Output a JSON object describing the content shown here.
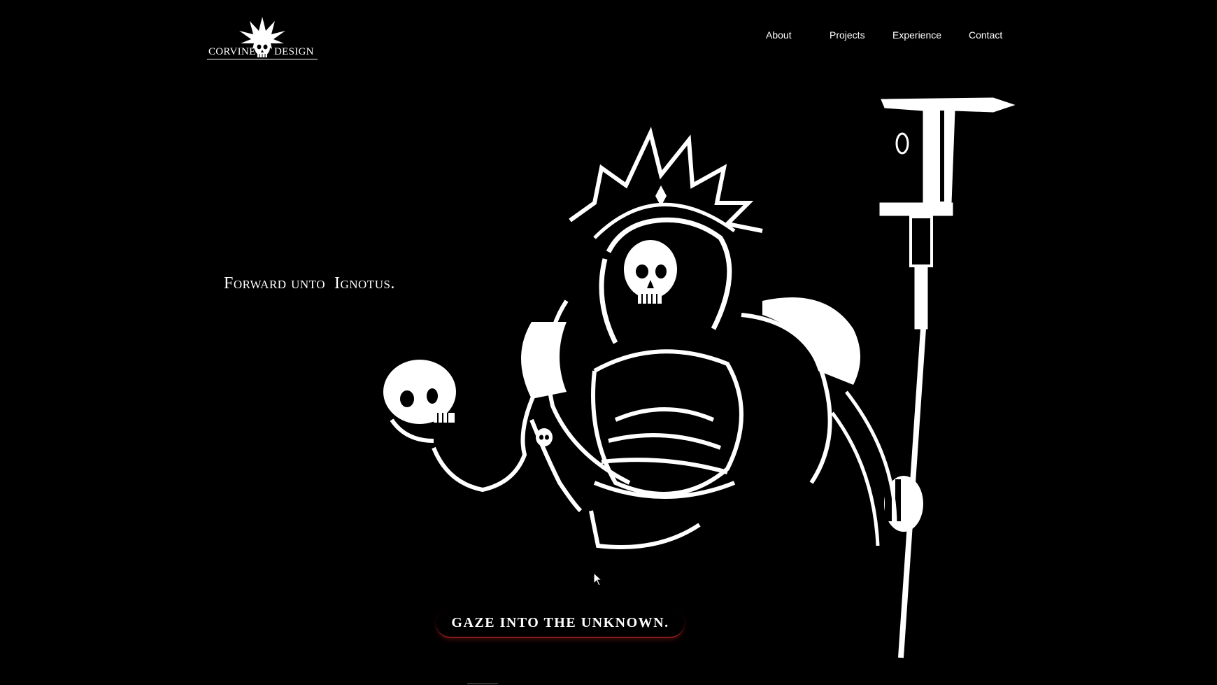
{
  "logo": {
    "left_word": "CORVINE",
    "right_word": "DESIGN"
  },
  "nav": {
    "items": [
      "About",
      "Projects",
      "Experience",
      "Contact"
    ]
  },
  "hero": {
    "tagline": "Forward unto  Ignotus.",
    "illustration": "skeletal-armored-warrior-with-halo-skull-and-staff"
  },
  "cta": {
    "label": "GAZE INTO THE UNKNOWN."
  },
  "colors": {
    "background": "#000000",
    "text": "#ffffff",
    "accent": "#8a1a1a"
  }
}
